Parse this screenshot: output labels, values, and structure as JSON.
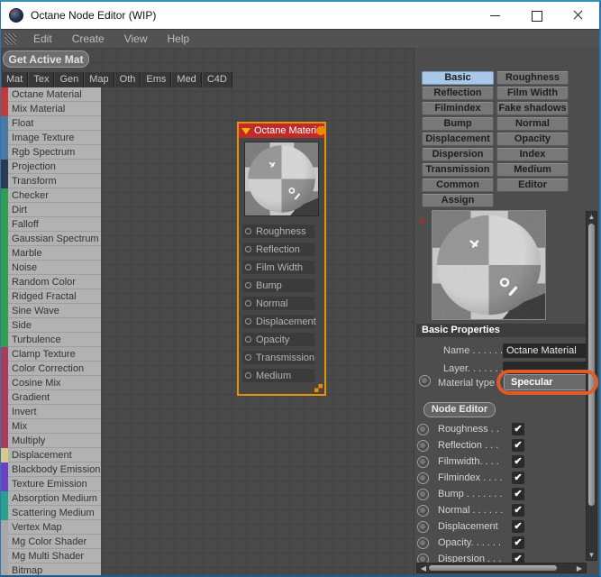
{
  "window": {
    "title": "Octane Node Editor (WIP)"
  },
  "menu": {
    "items": [
      "Edit",
      "Create",
      "View",
      "Help"
    ]
  },
  "toolbar": {
    "get_active_mat": "Get Active Mat"
  },
  "palette": {
    "tabs": [
      "Mat",
      "Tex",
      "Gen",
      "Map",
      "Oth",
      "Ems",
      "Med",
      "C4D"
    ],
    "items": [
      {
        "label": "Octane Material",
        "color": "red"
      },
      {
        "label": "Mix Material",
        "color": "red"
      },
      {
        "label": "Float",
        "color": "blue"
      },
      {
        "label": "Image Texture",
        "color": "blue"
      },
      {
        "label": "Rgb Spectrum",
        "color": "blue"
      },
      {
        "label": "Projection",
        "color": "navy"
      },
      {
        "label": "Transform",
        "color": "navy"
      },
      {
        "label": "Checker",
        "color": "green"
      },
      {
        "label": "Dirt",
        "color": "green"
      },
      {
        "label": "Falloff",
        "color": "green"
      },
      {
        "label": "Gaussian Spectrum",
        "color": "green"
      },
      {
        "label": "Marble",
        "color": "green"
      },
      {
        "label": "Noise",
        "color": "green"
      },
      {
        "label": "Random Color",
        "color": "green"
      },
      {
        "label": "Ridged Fractal",
        "color": "green"
      },
      {
        "label": "Sine Wave",
        "color": "green"
      },
      {
        "label": "Side",
        "color": "green"
      },
      {
        "label": "Turbulence",
        "color": "green"
      },
      {
        "label": "Clamp Texture",
        "color": "maroon"
      },
      {
        "label": "Color Correction",
        "color": "maroon"
      },
      {
        "label": "Cosine Mix",
        "color": "maroon"
      },
      {
        "label": "Gradient",
        "color": "maroon"
      },
      {
        "label": "Invert",
        "color": "maroon"
      },
      {
        "label": "Mix",
        "color": "maroon"
      },
      {
        "label": "Multiply",
        "color": "maroon"
      },
      {
        "label": "Displacement",
        "color": "tan"
      },
      {
        "label": "Blackbody Emission",
        "color": "purple"
      },
      {
        "label": "Texture Emission",
        "color": "purple"
      },
      {
        "label": "Absorption Medium",
        "color": "teal"
      },
      {
        "label": "Scattering Medium",
        "color": "teal"
      },
      {
        "label": "Vertex Map",
        "color": "gray"
      },
      {
        "label": "Mg Color Shader",
        "color": "gray"
      },
      {
        "label": "Mg Multi Shader",
        "color": "gray"
      },
      {
        "label": "Bitmap",
        "color": "gray"
      }
    ],
    "colors": {
      "red": "#c23a3a",
      "blue": "#4a79a8",
      "navy": "#2c3a54",
      "green": "#2f9e4e",
      "maroon": "#a63d5c",
      "tan": "#d9ca8c",
      "purple": "#6b40c2",
      "teal": "#2ba18d",
      "gray": "#a8a8a8"
    }
  },
  "node": {
    "title": "Octane Material",
    "ports": [
      "Roughness",
      "Reflection",
      "Film Width",
      "Bump",
      "Normal",
      "Displacement",
      "Opacity",
      "Transmission",
      "Medium"
    ],
    "header_color": "#bf2b2b",
    "selection_color": "#e8920a"
  },
  "inspector": {
    "buttons": [
      {
        "label": "Basic",
        "selected": true
      },
      {
        "label": "Roughness",
        "selected": false
      },
      {
        "label": "Reflection",
        "selected": false
      },
      {
        "label": "Film Width",
        "selected": false
      },
      {
        "label": "Filmindex",
        "selected": false
      },
      {
        "label": "Fake shadows",
        "selected": false
      },
      {
        "label": "Bump",
        "selected": false
      },
      {
        "label": "Normal",
        "selected": false
      },
      {
        "label": "Displacement",
        "selected": false
      },
      {
        "label": "Opacity",
        "selected": false
      },
      {
        "label": "Dispersion",
        "selected": false
      },
      {
        "label": "Index",
        "selected": false
      },
      {
        "label": "Transmission",
        "selected": false
      },
      {
        "label": "Medium",
        "selected": false
      },
      {
        "label": "Common",
        "selected": false
      },
      {
        "label": "Editor",
        "selected": false
      },
      {
        "label": "Assign",
        "selected": false
      }
    ],
    "selected_button_color": "#a9c7e8",
    "section": "Basic Properties",
    "fields": {
      "name_label": "Name . . . . . .",
      "name_value": "Octane Material",
      "layer_label": "Layer. . . . . . .",
      "layer_value": "",
      "material_type_label": "Material type",
      "material_type_value": "Specular"
    },
    "annotation_color": "#e05a2b",
    "node_editor_button": "Node Editor",
    "check_glyph": "✔",
    "checks": [
      {
        "label": "Roughness . .",
        "checked": true
      },
      {
        "label": "Reflection . . .",
        "checked": true
      },
      {
        "label": "Filmwidth. . . .",
        "checked": true
      },
      {
        "label": "Filmindex . . . .",
        "checked": true
      },
      {
        "label": "Bump . . . . . . .",
        "checked": true
      },
      {
        "label": "Normal . . . . . .",
        "checked": true
      },
      {
        "label": "Displacement",
        "checked": true
      },
      {
        "label": "Opacity. . . . . .",
        "checked": true
      },
      {
        "label": "Dispersion . . .",
        "checked": true
      }
    ]
  },
  "scrollbars": {
    "up": "▲",
    "down": "▼",
    "left": "◀",
    "right": "▶"
  }
}
